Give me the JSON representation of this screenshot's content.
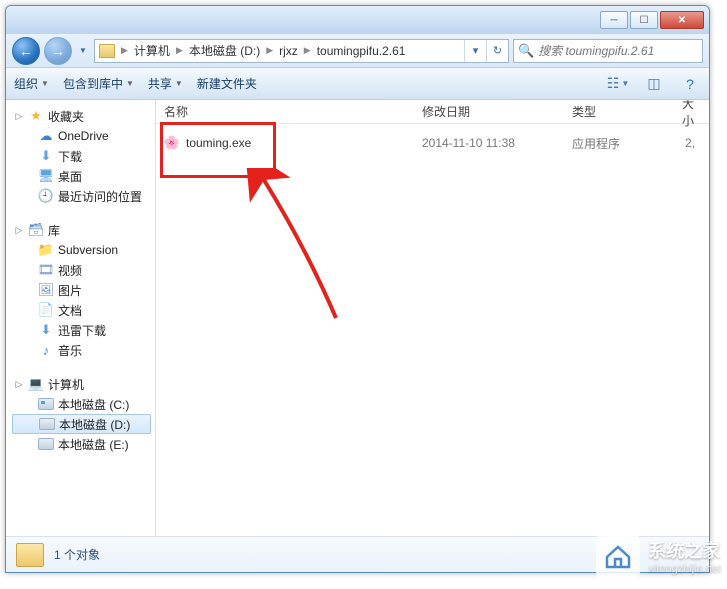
{
  "breadcrumb": {
    "root": "计算机",
    "seg1": "本地磁盘 (D:)",
    "seg2": "rjxz",
    "seg3": "toumingpifu.2.61"
  },
  "search": {
    "placeholder": "搜索 toumingpifu.2.61"
  },
  "toolbar": {
    "organize": "组织",
    "include": "包含到库中",
    "share": "共享",
    "newfolder": "新建文件夹"
  },
  "columns": {
    "name": "名称",
    "date": "修改日期",
    "type": "类型",
    "size": "大小"
  },
  "tree": {
    "favorites": "收藏夹",
    "onedrive": "OneDrive",
    "downloads": "下载",
    "desktop": "桌面",
    "recent": "最近访问的位置",
    "libraries": "库",
    "subversion": "Subversion",
    "videos": "视频",
    "pictures": "图片",
    "documents": "文档",
    "thunder": "迅雷下载",
    "music": "音乐",
    "computer": "计算机",
    "drive_c": "本地磁盘 (C:)",
    "drive_d": "本地磁盘 (D:)",
    "drive_e": "本地磁盘 (E:)"
  },
  "files": [
    {
      "icon": "🌸",
      "name": "touming.exe",
      "date": "2014-11-10 11:38",
      "type": "应用程序",
      "size": "2,"
    }
  ],
  "status": {
    "count": "1 个对象"
  },
  "watermark": {
    "title": "系统之家",
    "sub": "xitongzhijia.net"
  }
}
